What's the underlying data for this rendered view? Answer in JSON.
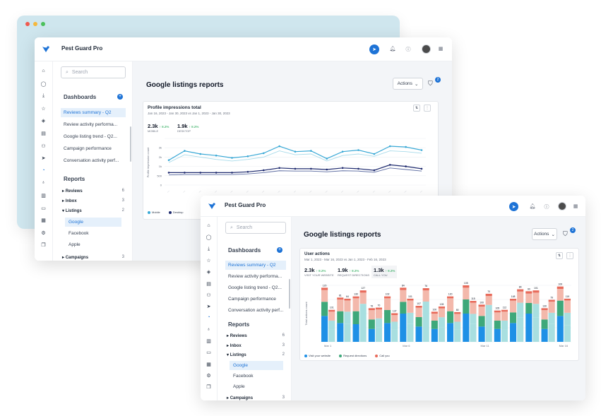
{
  "colors": {
    "accent": "#1e73d6",
    "dot_red": "#f05a4f",
    "dot_yellow": "#f5b83d",
    "dot_green": "#4cc15c",
    "line_light": "#a8dbea",
    "line_blue": "#3aa9d6",
    "line_dark": "#1e2a6e",
    "line_navy": "#5a6aa0",
    "bar_blue": "#1e90e6",
    "bar_teal": "#a8dfe0",
    "bar_green": "#3ea87a",
    "bar_pink": "#f3b8ab",
    "bar_red": "#e86a5a"
  },
  "app": {
    "title": "Pest Guard Pro"
  },
  "search": {
    "placeholder": "Search"
  },
  "sidebar": {
    "dashboards_title": "Dashboards",
    "dashboards": [
      "Reviews summary - Q2",
      "Review activity performa...",
      "Google listing trend - Q2...",
      "Campaign performance",
      "Conversation activity perf..."
    ],
    "reports_title": "Reports",
    "reports": [
      {
        "label": "Reviews",
        "count": "6"
      },
      {
        "label": "Inbox",
        "count": "3"
      },
      {
        "label": "Listings",
        "count": "2"
      }
    ],
    "listings_children": [
      "Google",
      "Facebook",
      "Apple"
    ],
    "campaigns": {
      "label": "Campaigns",
      "count": "3"
    }
  },
  "rail_icons": [
    "home-icon",
    "chat-icon",
    "download-icon",
    "star-icon",
    "diamond-icon",
    "document-icon",
    "people-icon",
    "send-icon",
    "pie-icon",
    "bulb-icon",
    "bar-chart-icon",
    "card-icon",
    "grid-icon",
    "settings-icon",
    "copy-icon"
  ],
  "page": {
    "title": "Google listings reports",
    "actions_label": "Actions",
    "filter_count": "2"
  },
  "chart1": {
    "title": "Profile impressions total",
    "subtitle": "Jan 16, 2023 - Jan 30, 2023  vs  Jan 1, 2023 - Jan 30, 2023",
    "stats": [
      {
        "value": "2.3k",
        "delta": "↑ 8.2%",
        "label": "MOBILE"
      },
      {
        "value": "1.9k",
        "delta": "↑ 8.2%",
        "label": "DESKTOP"
      }
    ],
    "legend": [
      "Mobile",
      "Desktop"
    ]
  },
  "chart2": {
    "title": "User actions",
    "subtitle": "Mar 1, 2023 - Mar 16, 2023  vs  Jan 1, 2023 - Feb 16, 2023",
    "stats": [
      {
        "value": "2.3k",
        "delta": "↑ 8.2%",
        "label": "VISIT YOUR WEBSITE"
      },
      {
        "value": "1.9k",
        "delta": "↑ 8.2%",
        "label": "REQUEST DIRECTIONS"
      },
      {
        "value": "1.3k",
        "delta": "↑ 8.2%",
        "label": "CALL YOU"
      }
    ],
    "xticks": [
      "Mar 1",
      "Mar 6",
      "Mar 11",
      "Mar 16"
    ],
    "legend": [
      "Visit your website",
      "Request directions",
      "Call you"
    ]
  },
  "chart_data": [
    {
      "type": "line",
      "title": "Profile impressions total",
      "ylabel": "Profile impression count",
      "yticks": [
        "",
        "3k",
        "2k",
        "1k",
        "500",
        "0"
      ],
      "ylim": [
        0,
        3
      ],
      "x": [
        1,
        2,
        3,
        4,
        5,
        6,
        7,
        8,
        9,
        10,
        11,
        12,
        13,
        14,
        15,
        16,
        17
      ],
      "series": [
        {
          "name": "Mobile",
          "values": [
            1.6,
            2.2,
            2.0,
            1.9,
            1.75,
            1.85,
            2.05,
            2.5,
            2.15,
            2.2,
            1.7,
            2.15,
            2.25,
            2.0,
            2.5,
            2.45,
            2.25
          ]
        },
        {
          "name": "",
          "values": [
            1.45,
            1.95,
            1.8,
            1.65,
            1.55,
            1.65,
            1.8,
            2.2,
            1.95,
            2.0,
            1.55,
            1.9,
            2.0,
            1.85,
            2.2,
            2.15,
            2.05
          ]
        },
        {
          "name": "Desktop",
          "values": [
            0.8,
            0.8,
            0.8,
            0.8,
            0.8,
            0.85,
            0.95,
            1.1,
            1.05,
            1.05,
            1.0,
            1.1,
            1.05,
            0.95,
            1.3,
            1.2,
            1.05
          ]
        },
        {
          "name": "",
          "values": [
            0.65,
            0.68,
            0.68,
            0.68,
            0.68,
            0.72,
            0.8,
            0.92,
            0.9,
            0.9,
            0.85,
            0.92,
            0.9,
            0.82,
            1.1,
            1.0,
            0.9
          ]
        }
      ]
    },
    {
      "type": "bar",
      "title": "User actions",
      "ylabel": "Total actions count",
      "stacked": true,
      "ylim": [
        0,
        240
      ],
      "categories": [
        "Mar 1",
        "",
        "",
        "",
        "",
        "Mar 6",
        "",
        "",
        "",
        "",
        "Mar 11",
        "",
        "",
        "",
        "",
        "Mar 16"
      ],
      "series": [
        {
          "name": "Visit your website",
          "values": [
            110,
            80,
            75,
            55,
            80,
            120,
            65,
            55,
            80,
            120,
            65,
            55,
            80,
            120,
            55,
            110
          ]
        },
        {
          "name": "Request directions",
          "values": [
            60,
            50,
            55,
            40,
            55,
            50,
            40,
            35,
            50,
            60,
            45,
            35,
            45,
            45,
            40,
            65
          ]
        },
        {
          "name": "Call you",
          "values": [
            50,
            50,
            55,
            40,
            50,
            50,
            40,
            30,
            55,
            50,
            40,
            35,
            50,
            40,
            40,
            50
          ]
        },
        {
          "name": "",
          "values": [
            10,
            8,
            8,
            8,
            8,
            10,
            8,
            8,
            8,
            10,
            8,
            8,
            8,
            10,
            8,
            10
          ]
        }
      ],
      "totals": [
        "120",
        "101",
        "81",
        "64",
        "130",
        "127",
        "76",
        "70",
        "102",
        "137",
        "84",
        "101",
        "107",
        "76",
        "100",
        "128",
        "120",
        "80",
        "105",
        "115",
        "100",
        "70",
        "105",
        "112",
        "148",
        "84",
        "90",
        "101",
        "130",
        "79",
        "100",
        "119"
      ]
    }
  ]
}
